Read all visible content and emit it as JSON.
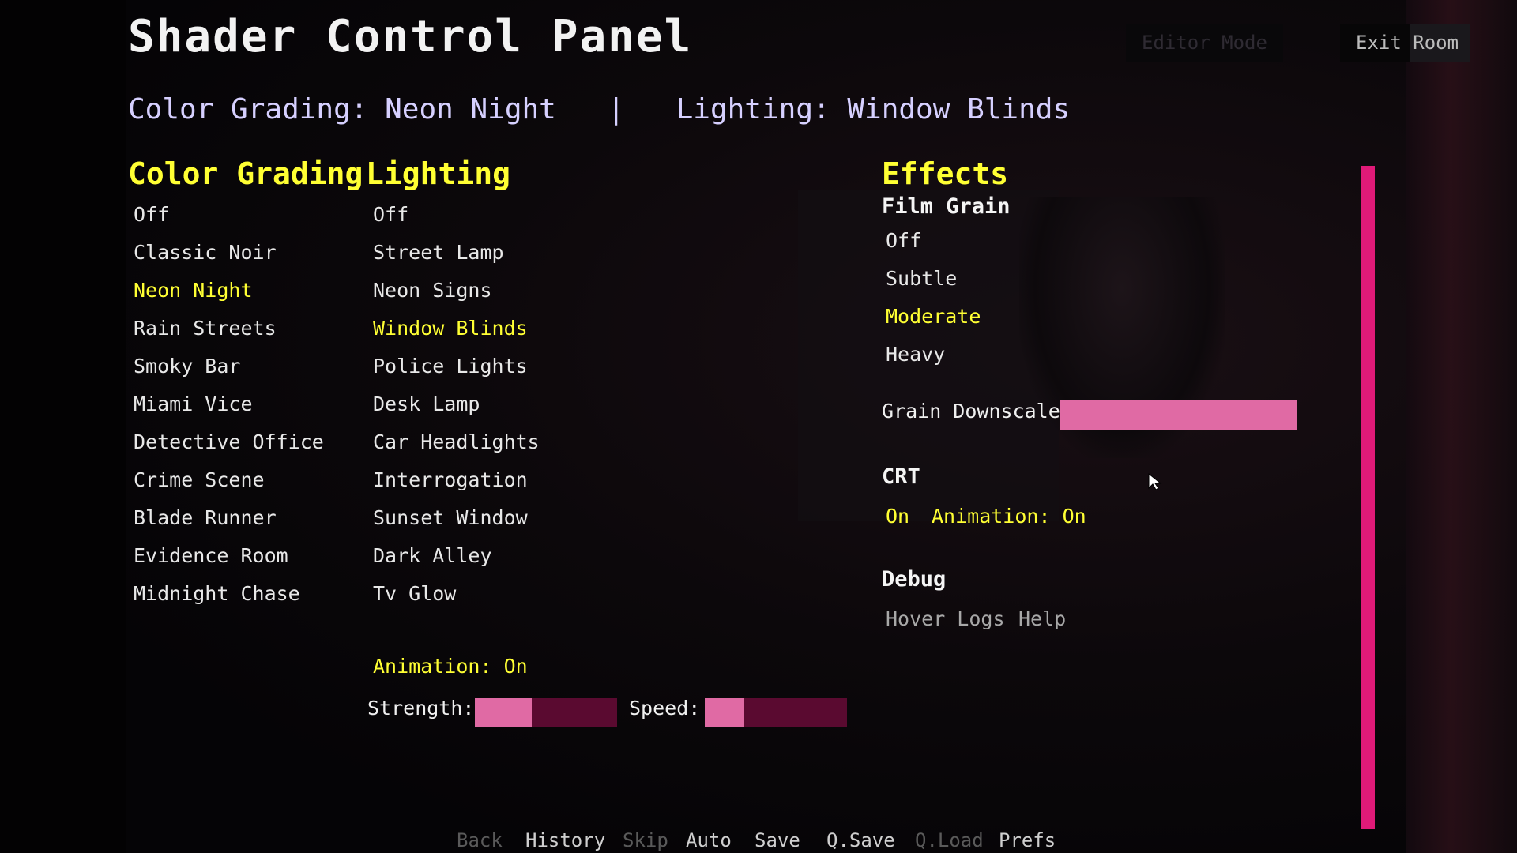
{
  "title": "Shader Control Panel",
  "status": {
    "color_grading": "Color Grading: Neon Night",
    "separator": "|",
    "lighting": "Lighting: Window Blinds"
  },
  "top_buttons": {
    "editor_mode": "Editor Mode",
    "exit_room": "Exit Room"
  },
  "color_grading": {
    "heading": "Color Grading",
    "selected": "Neon Night",
    "items": [
      "Off",
      "Classic Noir",
      "Neon Night",
      "Rain Streets",
      "Smoky Bar",
      "Miami Vice",
      "Detective Office",
      "Crime Scene",
      "Blade Runner",
      "Evidence Room",
      "Midnight Chase"
    ]
  },
  "lighting": {
    "heading": "Lighting",
    "selected": "Window Blinds",
    "items": [
      "Off",
      "Street Lamp",
      "Neon Signs",
      "Window Blinds",
      "Police Lights",
      "Desk Lamp",
      "Car Headlights",
      "Interrogation",
      "Sunset Window",
      "Dark Alley",
      "Tv Glow"
    ],
    "animation": "Animation: On",
    "strength_label": "Strength:",
    "strength_value": 0.4,
    "speed_label": "Speed:",
    "speed_value": 0.28
  },
  "effects": {
    "heading": "Effects",
    "film_grain": {
      "heading": "Film Grain",
      "selected": "Moderate",
      "items": [
        "Off",
        "Subtle",
        "Moderate",
        "Heavy"
      ],
      "downscale_label": "Grain Downscale:",
      "downscale_value": 1.0
    },
    "crt": {
      "heading": "CRT",
      "on": "On",
      "animation": "Animation: On"
    },
    "debug": {
      "heading": "Debug",
      "hover_logs": "Hover Logs",
      "help": "Help"
    }
  },
  "quick_menu": [
    {
      "label": "Back",
      "enabled": false
    },
    {
      "label": "History",
      "enabled": true
    },
    {
      "label": "Skip",
      "enabled": false
    },
    {
      "label": "Auto",
      "enabled": true
    },
    {
      "label": "Save",
      "enabled": true
    },
    {
      "label": "Q.Save",
      "enabled": true
    },
    {
      "label": "Q.Load",
      "enabled": false
    },
    {
      "label": "Prefs",
      "enabled": true
    }
  ],
  "colors": {
    "accent_yellow": "#ffff33",
    "bar_fill": "#e06aa4",
    "bar_track": "#5a0a30",
    "scrollbar": "#e01a78"
  }
}
